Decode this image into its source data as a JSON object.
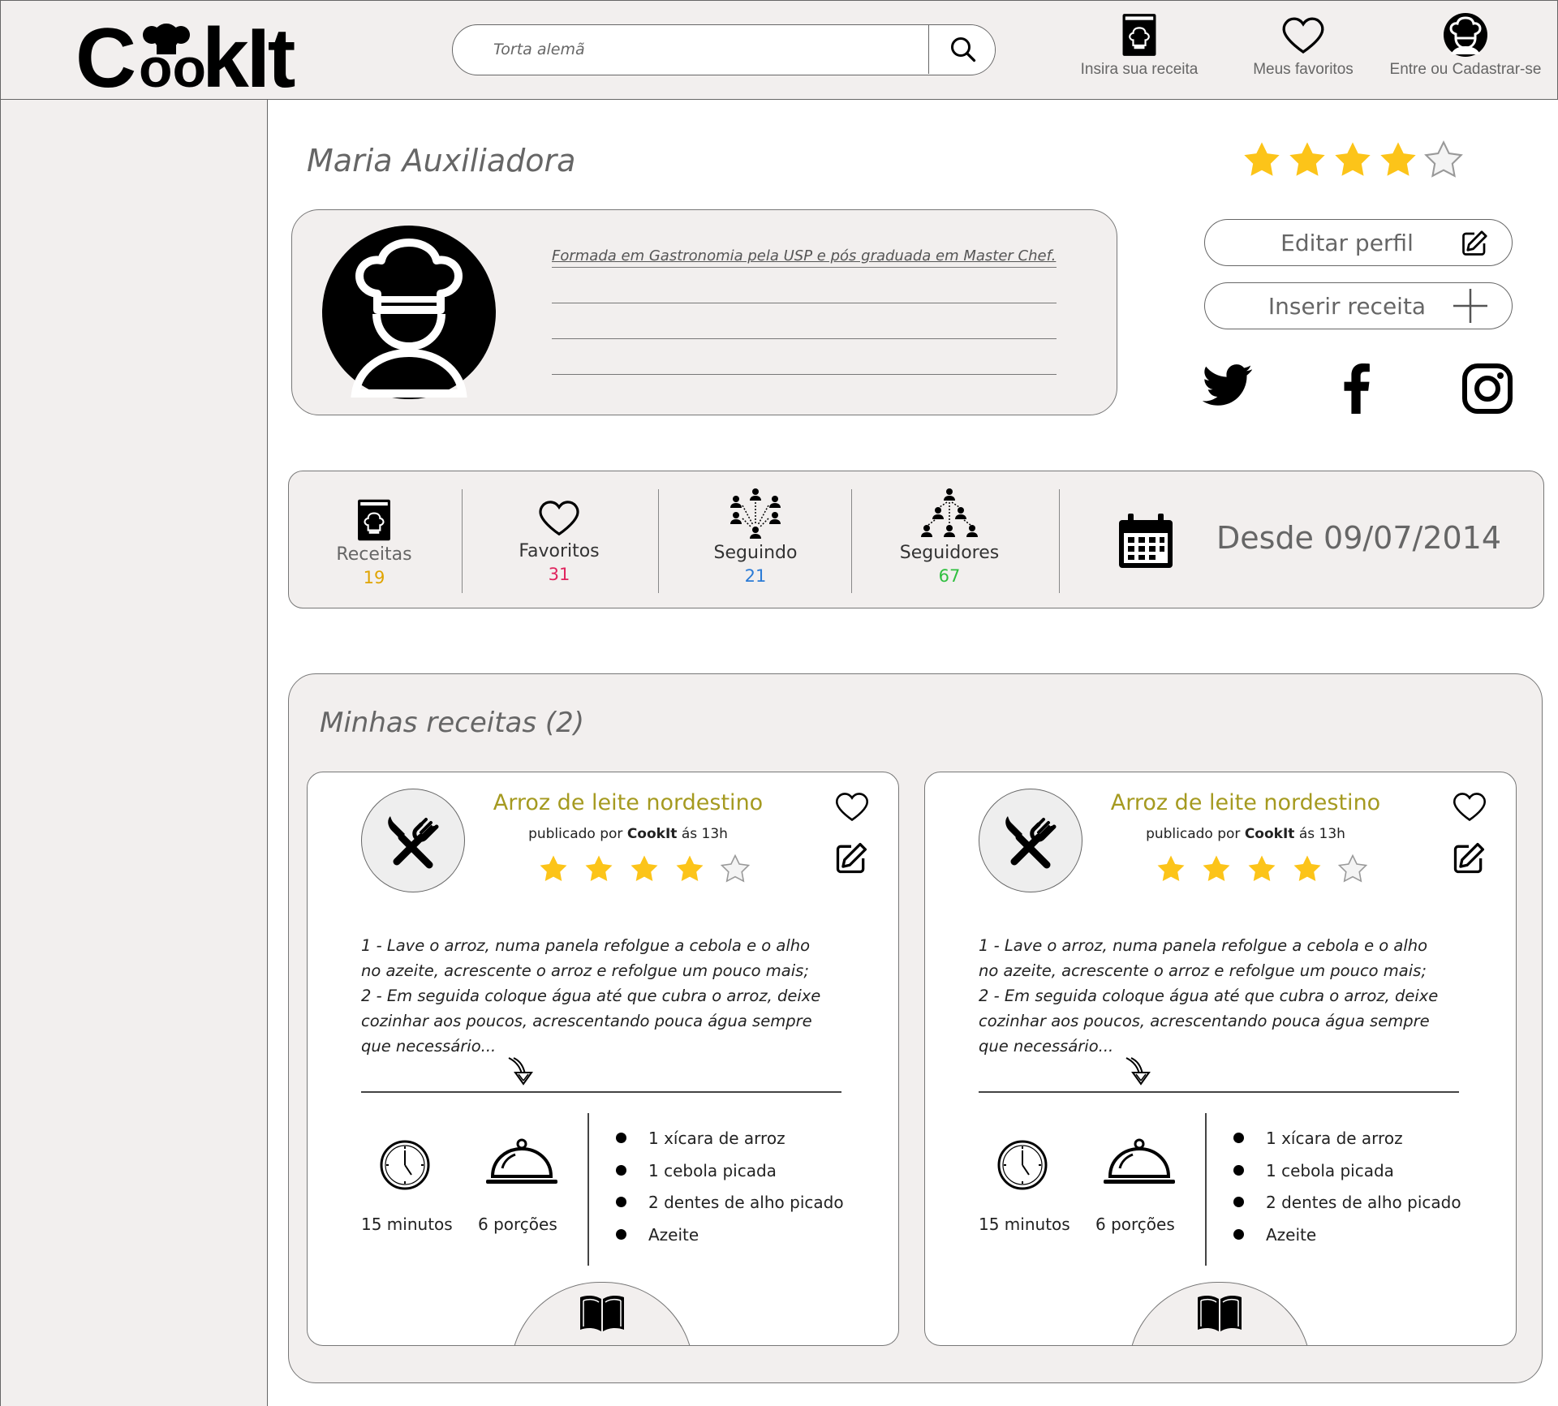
{
  "header": {
    "logo": "CookIt",
    "search": {
      "value": "Torta alemã",
      "placeholder": ""
    },
    "nav": {
      "insert_recipe": "Insira sua receita",
      "favorites": "Meus favoritos",
      "login": "Entre ou Cadastrar-se"
    }
  },
  "profile": {
    "name": "Maria Auxiliadora",
    "rating": 4,
    "rating_max": 5,
    "bio": "Formada em Gastronomia pela USP e pós graduada em Master Chef.",
    "buttons": {
      "edit": "Editar perfil",
      "insert": "Inserir receita"
    },
    "social": [
      "twitter-icon",
      "facebook-icon",
      "instagram-icon"
    ]
  },
  "stats": {
    "recipes": {
      "label": "Receitas",
      "value": "19",
      "color": "#e0a400"
    },
    "favorites": {
      "label": "Favoritos",
      "value": "31",
      "color": "#e0245e"
    },
    "following": {
      "label": "Seguindo",
      "value": "21",
      "color": "#2b7bd6"
    },
    "followers": {
      "label": "Seguidores",
      "value": "67",
      "color": "#2fbf3f"
    },
    "since": "Desde 09/07/2014"
  },
  "recipes_section": {
    "title": "Minhas receitas (2)",
    "items": [
      {
        "title": "Arroz de leite nordestino",
        "by_prefix": "publicado por",
        "author": "CookIt",
        "time_suffix": "ás 13h",
        "rating": 4,
        "steps": [
          "1 - Lave o arroz, numa panela refolgue a cebola e o alho",
          "no azeite, acrescente o arroz e refolgue um pouco mais;",
          "2 - Em seguida coloque água até que cubra o arroz, deixe",
          "cozinhar aos poucos, acrescentando pouca água sempre",
          "que necessário..."
        ],
        "time": "15 minutos",
        "servings": "6 porções",
        "ingredients": [
          "1 xícara de arroz",
          "1 cebola picada",
          "2 dentes de alho picado",
          "Azeite"
        ]
      },
      {
        "title": "Arroz de leite nordestino",
        "by_prefix": "publicado por",
        "author": "CookIt",
        "time_suffix": "ás 13h",
        "rating": 4,
        "steps": [
          "1 - Lave o arroz, numa panela refolgue a cebola e o alho",
          "no azeite, acrescente o arroz e refolgue um pouco mais;",
          "2 - Em seguida coloque água até que cubra o arroz, deixe",
          "cozinhar aos poucos, acrescentando pouca água sempre",
          "que necessário..."
        ],
        "time": "15 minutos",
        "servings": "6 porções",
        "ingredients": [
          "1 xícara de arroz",
          "1 cebola picada",
          "2 dentes de alho picado",
          "Azeite"
        ]
      }
    ]
  },
  "colors": {
    "star_filled": "#fcc419",
    "recipe_title": "#a59a20",
    "panel_bg": "#f2efee"
  }
}
